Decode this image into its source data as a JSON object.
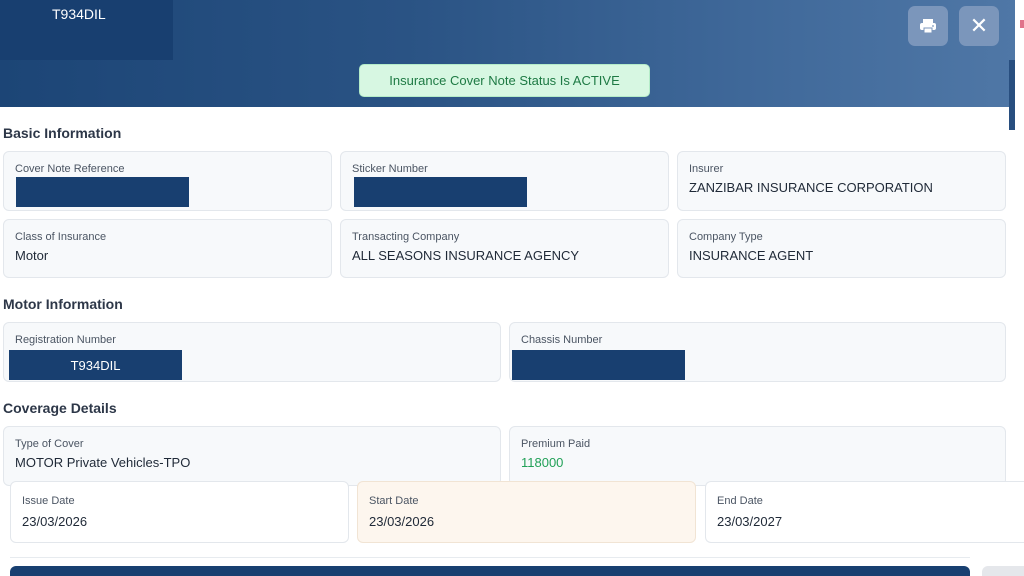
{
  "header": {
    "plate_number": "T934DIL",
    "print_icon": "printer-icon",
    "close_icon": "close-icon",
    "close_glyph": "✕"
  },
  "status": {
    "text": "Insurance Cover Note Status Is ACTIVE",
    "color": "#1e7a44"
  },
  "sections": {
    "basic": "Basic Information",
    "motor": "Motor Information",
    "coverage": "Coverage Details"
  },
  "basic": {
    "cover_note_reference": {
      "label": "Cover Note Reference",
      "value": ""
    },
    "sticker_number": {
      "label": "Sticker Number",
      "value": ""
    },
    "insurer": {
      "label": "Insurer",
      "value": "ZANZIBAR INSURANCE CORPORATION"
    },
    "class_of_insurance": {
      "label": "Class of Insurance",
      "value": "Motor"
    },
    "transacting_company": {
      "label": "Transacting Company",
      "value": "ALL SEASONS INSURANCE AGENCY"
    },
    "company_type": {
      "label": "Company Type",
      "value": "INSURANCE AGENT"
    }
  },
  "motor": {
    "registration_number": {
      "label": "Registration Number",
      "value": "T934DIL"
    },
    "chassis_number": {
      "label": "Chassis Number",
      "value": ""
    }
  },
  "coverage": {
    "type_of_cover": {
      "label": "Type of Cover",
      "value": "MOTOR Private Vehicles-TPO"
    },
    "premium_paid": {
      "label": "Premium Paid",
      "value": "118000",
      "color": "#22a158"
    }
  },
  "dates": {
    "issue": {
      "label": "Issue Date",
      "value": "23/03/2026"
    },
    "start": {
      "label": "Start Date",
      "value": "23/03/2026"
    },
    "end": {
      "label": "End Date",
      "value": "23/03/2027"
    }
  },
  "colors": {
    "header": "#1c4576",
    "redaction": "#183f70",
    "accent_green": "#22a158"
  }
}
